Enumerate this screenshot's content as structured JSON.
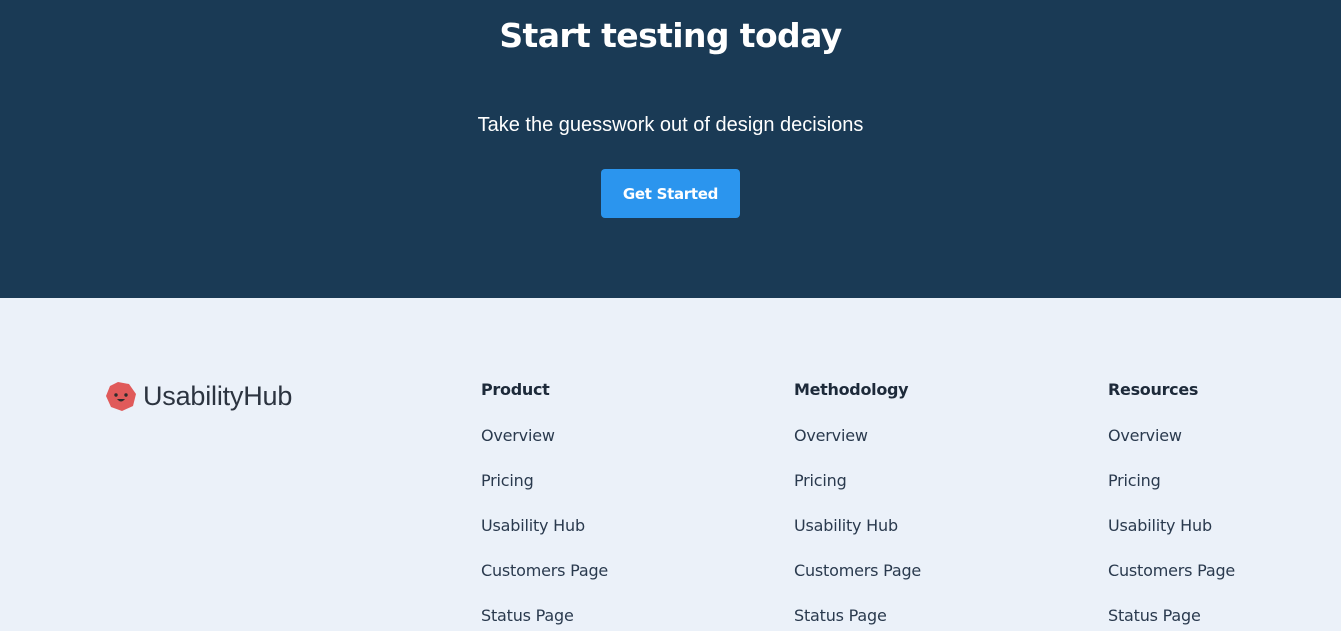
{
  "cta": {
    "title": "Start testing today",
    "subtitle": "Take the guesswork out of design decisions",
    "button_label": "Get Started"
  },
  "footer": {
    "brand": "UsabilityHub",
    "columns": [
      {
        "heading": "Product",
        "links": [
          "Overview",
          "Pricing",
          "Usability Hub",
          "Customers Page",
          "Status Page"
        ]
      },
      {
        "heading": "Methodology",
        "links": [
          "Overview",
          "Pricing",
          "Usability Hub",
          "Customers Page",
          "Status Page"
        ]
      },
      {
        "heading": "Resources",
        "links": [
          "Overview",
          "Pricing",
          "Usability Hub",
          "Customers Page",
          "Status Page"
        ]
      }
    ]
  },
  "colors": {
    "cta_background": "#1a3a55",
    "button": "#2b95ee",
    "footer_background": "#ebf1f9",
    "logo_mark": "#e05a5a"
  },
  "icons": {
    "logo": "smiling-hexagon-logo-icon"
  }
}
